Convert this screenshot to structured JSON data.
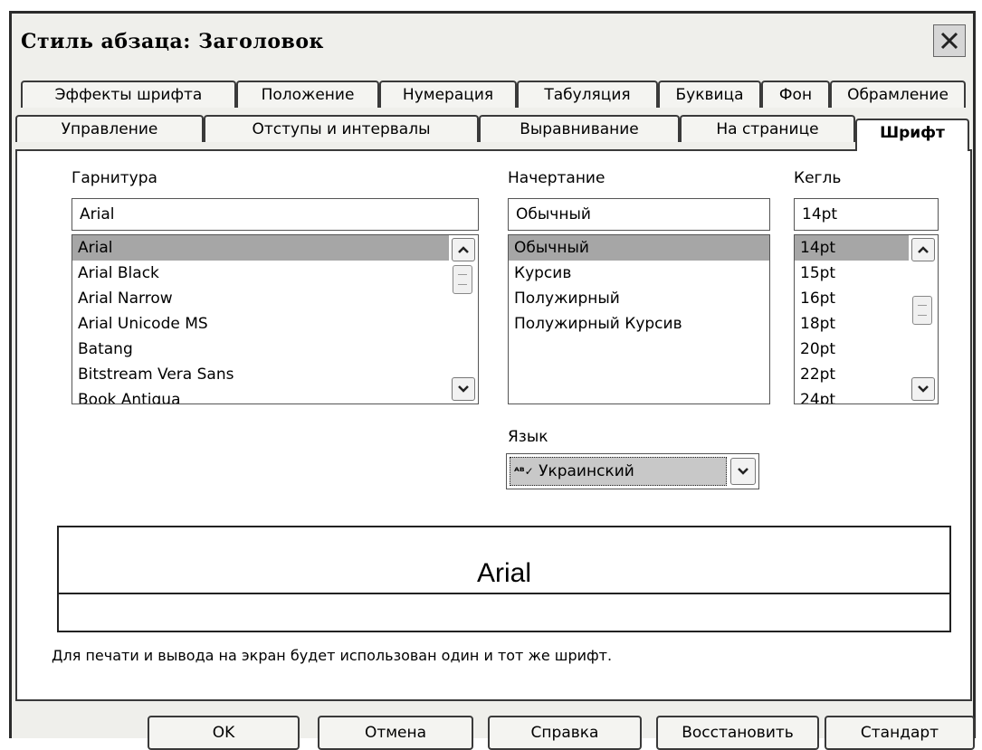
{
  "dialog": {
    "title": "Стиль абзаца: Заголовок"
  },
  "tabs_row1": [
    "Эффекты шрифта",
    "Положение",
    "Нумерация",
    "Табуляция",
    "Буквица",
    "Фон",
    "Обрамление"
  ],
  "tabs_row2": [
    "Управление",
    "Отступы и интервалы",
    "Выравнивание",
    "На странице",
    "Шрифт"
  ],
  "font": {
    "family_label": "Гарнитура",
    "family_value": "Arial",
    "family_list": [
      "Arial",
      "Arial Black",
      "Arial Narrow",
      "Arial Unicode MS",
      "Batang",
      "Bitstream Vera Sans",
      "Book Antiqua"
    ],
    "style_label": "Начертание",
    "style_value": "Обычный",
    "style_list": [
      "Обычный",
      "Курсив",
      "Полужирный",
      "Полужирный Курсив"
    ],
    "size_label": "Кегль",
    "size_value": "14pt",
    "size_list": [
      "14pt",
      "15pt",
      "16pt",
      "18pt",
      "20pt",
      "22pt",
      "24pt"
    ],
    "lang_label": "Язык",
    "lang_value": "Украинский"
  },
  "preview": {
    "text": "Arial"
  },
  "note": "Для печати и вывода на экран будет использован один и тот же шрифт.",
  "buttons": {
    "ok": "OK",
    "cancel": "Отмена",
    "help": "Справка",
    "restore": "Восстановить",
    "standard": "Стандарт"
  }
}
